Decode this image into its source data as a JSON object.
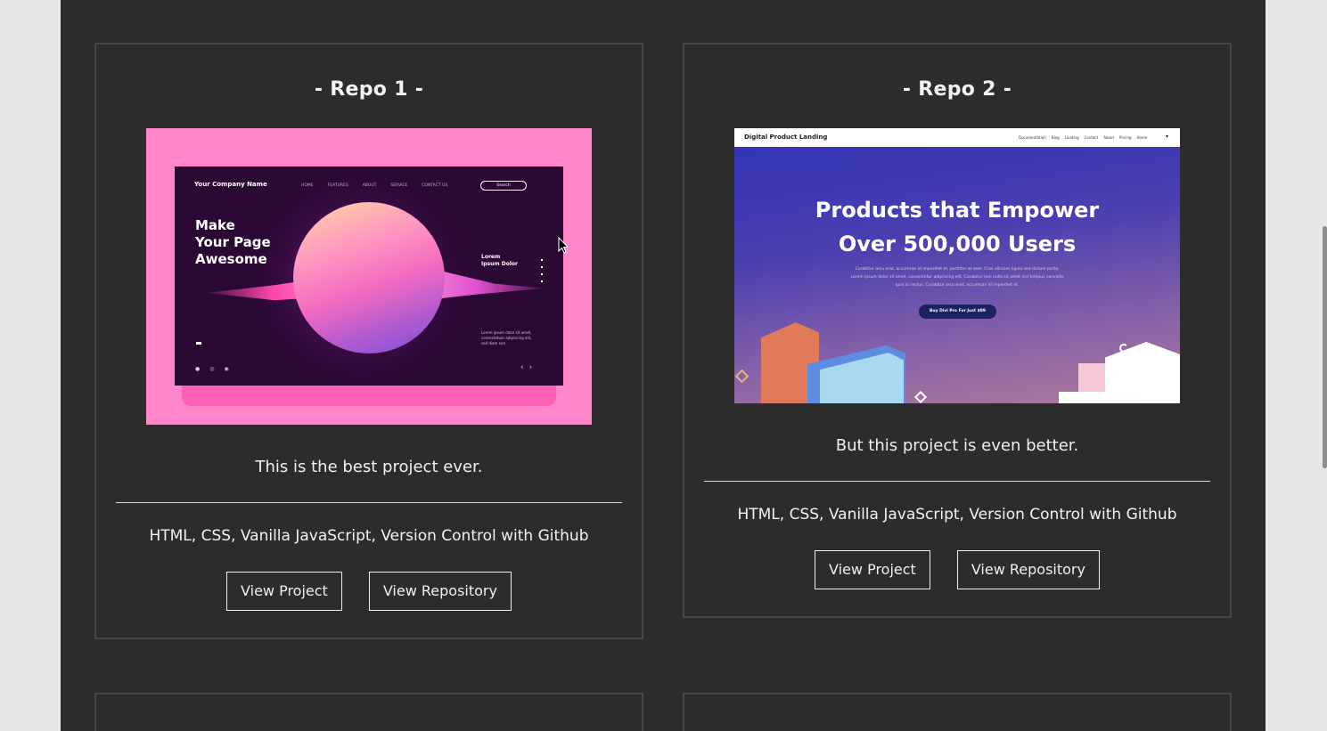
{
  "projects": [
    {
      "title": "- Repo 1 -",
      "description": "This is the best project ever.",
      "tech": "HTML, CSS, Vanilla JavaScript, Version Control with Github",
      "view_project": "View Project",
      "view_repository": "View Repository",
      "preview": {
        "company": "Your Company Name",
        "nav": [
          "HOME",
          "FEATURES",
          "ABOUT",
          "SERVICE",
          "CONTACT US"
        ],
        "search": "Search",
        "headline": "Make\nYour Page\nAwesome",
        "side": "Lorem\nIpsum Dolor",
        "small": "Lorem ipsum dolor sit amet, consectetuer adipiscing elit, sed diam non",
        "colors": {
          "background": "#ff86c8",
          "screen": "#2a0834"
        }
      }
    },
    {
      "title": "- Repo 2 -",
      "description": "But this project is even better.",
      "tech": "HTML, CSS, Vanilla JavaScript, Version Control with Github",
      "view_project": "View Project",
      "view_repository": "View Repository",
      "preview": {
        "brand": "Digital Product Landing",
        "nav": [
          "Documentation",
          "Blog",
          "Landing",
          "Contact",
          "About",
          "Pricing",
          "Home"
        ],
        "headline": "Products that Empower\nOver 500,000 Users",
        "copy": "Curabitur arcu erat, accumsan id imperdiet et, porttitor at sem. Cras ultricies ligula sed dictum porta. Lorem ipsum dolor sit amet, consectetur adipiscing elit. Curabitur non nulla sit amet nisl tempus convallis quis ac lectus. Curabitur arcu erat, accumsan id imperdiet et.",
        "cta": "Buy Divi Pro For Just $89",
        "colors": {
          "gradient_start": "#3032b4",
          "gradient_end": "#b07a98"
        }
      }
    }
  ],
  "theme": {
    "page_bg": "#2c2c2c",
    "outer_bg": "#e7e7e7",
    "card_border": "#474747",
    "text": "#f0f0f0"
  }
}
